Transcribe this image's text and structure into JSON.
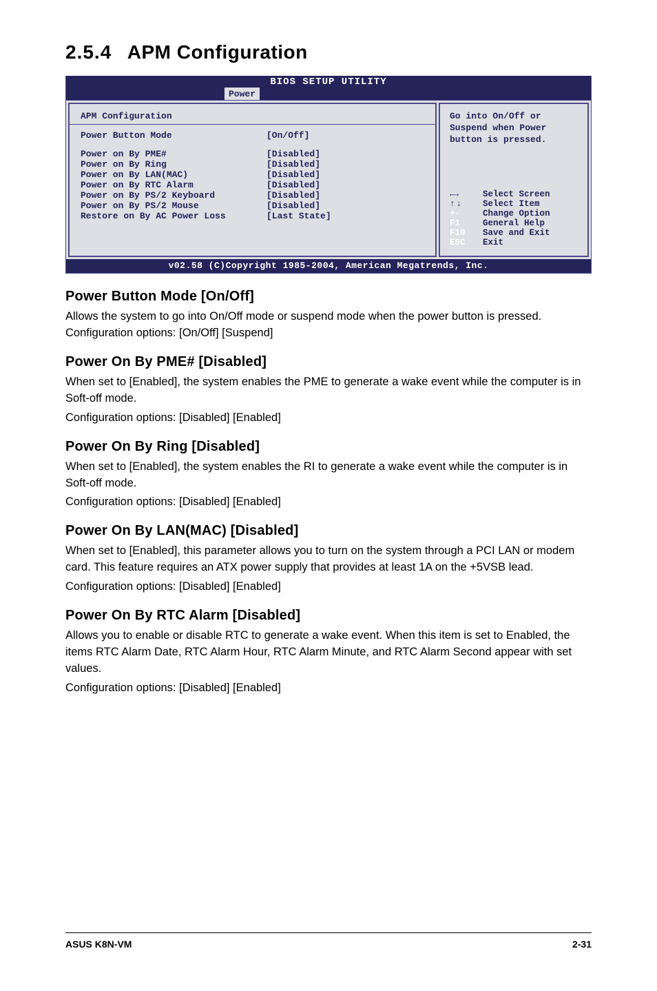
{
  "section": {
    "number": "2.5.4",
    "title": "APM Configuration"
  },
  "bios": {
    "title": "BIOS SETUP UTILITY",
    "tab": "Power",
    "panel_title": "APM Configuration",
    "rows": {
      "pbm": {
        "label": "Power Button Mode",
        "value": "[On/Off]"
      },
      "pme": {
        "label": "Power on By PME#",
        "value": "[Disabled]"
      },
      "ring": {
        "label": "Power on By Ring",
        "value": "[Disabled]"
      },
      "lan": {
        "label": "Power on By LAN(MAC)",
        "value": "[Disabled]"
      },
      "rtc": {
        "label": "Power on By RTC Alarm",
        "value": "[Disabled]"
      },
      "ps2k": {
        "label": "Power on By PS/2 Keyboard",
        "value": "[Disabled]"
      },
      "ps2m": {
        "label": "Power on By PS/2 Mouse",
        "value": "[Disabled]"
      },
      "restore": {
        "label": "Restore on By AC Power Loss",
        "value": "[Last State]"
      }
    },
    "help": {
      "line1": "Go into On/Off or",
      "line2": "Suspend when Power",
      "line3": "button is pressed."
    },
    "legend": {
      "screen": {
        "desc": "Select Screen"
      },
      "item": {
        "key": "↑↓",
        "desc": "Select Item"
      },
      "change": {
        "key": "+-",
        "desc": "Change Option"
      },
      "help": {
        "key": "F1",
        "desc": "General Help"
      },
      "save": {
        "key": "F10",
        "desc": "Save and Exit"
      },
      "exit": {
        "key": "ESC",
        "desc": "Exit"
      }
    },
    "footer": "v02.58 (C)Copyright 1985-2004, American Megatrends, Inc."
  },
  "content": {
    "pbm": {
      "heading": "Power Button Mode [On/Off]",
      "p1": "Allows the system to go into On/Off mode or suspend mode when the power  button is pressed. Configuration options: [On/Off] [Suspend]"
    },
    "pme": {
      "heading": "Power On By PME# [Disabled]",
      "p1": "When set to [Enabled], the system enables the PME to generate a wake event while the computer is in Soft-off mode.",
      "p2": "Configuration options: [Disabled] [Enabled]"
    },
    "ring": {
      "heading": "Power On By Ring [Disabled]",
      "p1": "When set to [Enabled], the system enables the RI to generate a wake event while the computer is in Soft-off mode.",
      "p2": "Configuration options: [Disabled] [Enabled]"
    },
    "lan": {
      "heading": "Power On By LAN(MAC) [Disabled]",
      "p1": "When set to [Enabled], this parameter allows you to turn on the system through a PCI LAN or modem card. This feature requires an ATX power supply that provides at least 1A on the +5VSB lead.",
      "p2": "Configuration options: [Disabled] [Enabled]"
    },
    "rtc": {
      "heading": "Power On By RTC Alarm [Disabled]",
      "p1": "Allows you to enable or disable RTC to generate a wake event. When this item is set to Enabled, the items RTC Alarm Date, RTC Alarm Hour, RTC Alarm Minute, and RTC Alarm Second appear with set values.",
      "p2": "Configuration options: [Disabled] [Enabled]"
    }
  },
  "footer": {
    "left": "ASUS K8N-VM",
    "right": "2-31"
  }
}
